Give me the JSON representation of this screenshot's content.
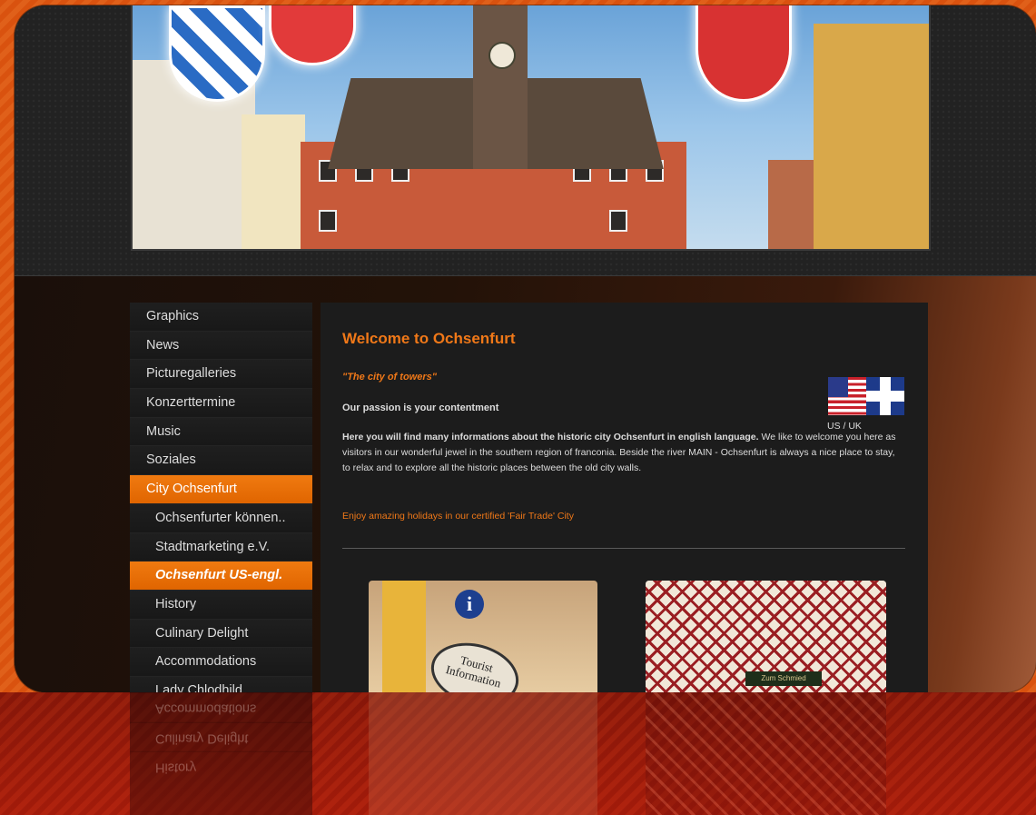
{
  "header": {
    "banner_alt": "Ochsenfurt town hall"
  },
  "nav": {
    "items": [
      {
        "label": "Graphics",
        "sub": false,
        "state": ""
      },
      {
        "label": "News",
        "sub": false,
        "state": ""
      },
      {
        "label": "Picturegalleries",
        "sub": false,
        "state": ""
      },
      {
        "label": "Konzerttermine",
        "sub": false,
        "state": ""
      },
      {
        "label": "Music",
        "sub": false,
        "state": ""
      },
      {
        "label": "Soziales",
        "sub": false,
        "state": ""
      },
      {
        "label": "City Ochsenfurt",
        "sub": false,
        "state": "active"
      },
      {
        "label": "Ochsenfurter können..",
        "sub": true,
        "state": ""
      },
      {
        "label": "Stadtmarketing e.V.",
        "sub": true,
        "state": ""
      },
      {
        "label": "Ochsenfurt US-engl.",
        "sub": true,
        "state": "current"
      },
      {
        "label": "History",
        "sub": true,
        "state": ""
      },
      {
        "label": "Culinary Delight",
        "sub": true,
        "state": ""
      },
      {
        "label": "Accommodations",
        "sub": true,
        "state": ""
      },
      {
        "label": "Lady Chlodhild",
        "sub": true,
        "state": ""
      }
    ]
  },
  "content": {
    "title": "Welcome to Ochsenfurt",
    "motto": "\"The city of towers\"",
    "passion": "Our passion is your contentment",
    "intro_bold": "Here you will find many informations about the historic city Ochsenfurt in english language.",
    "intro_rest": " We like to welcome you here as visitors in our wonderful jewel in the southern region of franconia. Beside the river MAIN - Ochsenfurt is always a nice place to stay, to relax and to explore all the historic places between the old city walls.",
    "fair_trade": "Enjoy amazing holidays in our certified 'Fair Trade' City",
    "flag_label": "US / UK",
    "photo1_sign": "Tourist Information",
    "photo1_icon": "i",
    "photo2_sign": "Zum Schmied"
  },
  "reflection": {
    "items": [
      "History",
      "Culinary Delight",
      "Accommodations"
    ]
  },
  "colors": {
    "accent": "#f07818",
    "nav_active": "#e06500",
    "background_stripe": "#d9520f"
  }
}
